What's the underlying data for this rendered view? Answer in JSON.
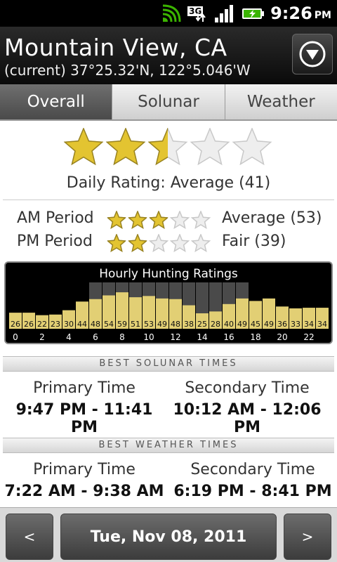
{
  "status_bar": {
    "time": "9:26",
    "ampm": "PM",
    "network": "3G"
  },
  "header": {
    "title": "Mountain View, CA",
    "subtitle": "(current)  37°25.32'N,  122°5.046'W"
  },
  "tabs": [
    {
      "label": "Overall",
      "active": true
    },
    {
      "label": "Solunar",
      "active": false
    },
    {
      "label": "Weather",
      "active": false
    }
  ],
  "daily": {
    "stars": 2.5,
    "label": "Daily Rating: Average (41)"
  },
  "periods": [
    {
      "label": "AM Period",
      "stars": 3,
      "value": "Average (53)"
    },
    {
      "label": "PM Period",
      "stars": 2,
      "value": "Fair (39)"
    }
  ],
  "chart_data": {
    "type": "bar",
    "title": "Hourly Hunting Ratings",
    "categories": [
      "0",
      "1",
      "2",
      "3",
      "4",
      "5",
      "6",
      "7",
      "8",
      "9",
      "10",
      "11",
      "12",
      "13",
      "14",
      "15",
      "16",
      "17",
      "18",
      "19",
      "20",
      "21",
      "22",
      "23"
    ],
    "values": [
      26,
      26,
      22,
      23,
      30,
      44,
      48,
      54,
      59,
      51,
      53,
      49,
      48,
      38,
      25,
      28,
      40,
      49,
      45,
      49,
      36,
      33,
      34,
      34
    ],
    "tick_labels": [
      "0",
      "2",
      "4",
      "6",
      "8",
      "10",
      "12",
      "14",
      "16",
      "18",
      "20",
      "22"
    ],
    "dark_hours": [
      6,
      7,
      8,
      9,
      10,
      11,
      12,
      13,
      14,
      15,
      16,
      17
    ],
    "ylim": [
      0,
      100
    ]
  },
  "solunar": {
    "band_label": "BEST SOLUNAR TIMES",
    "primary_label": "Primary Time",
    "primary_value": "9:47 PM - 11:41 PM",
    "secondary_label": "Secondary Time",
    "secondary_value": "10:12 AM - 12:06 PM"
  },
  "weather": {
    "band_label": "BEST WEATHER TIMES",
    "primary_label": "Primary Time",
    "primary_value": "7:22 AM - 9:38 AM",
    "secondary_label": "Secondary Time",
    "secondary_value": "6:19 PM - 8:41 PM"
  },
  "nav": {
    "prev": "<",
    "date": "Tue, Nov 08, 2011",
    "next": ">"
  },
  "colors": {
    "star_gold": "#e3c431",
    "bar_fill": "#e2cf74",
    "accent_dark": "#000000"
  }
}
